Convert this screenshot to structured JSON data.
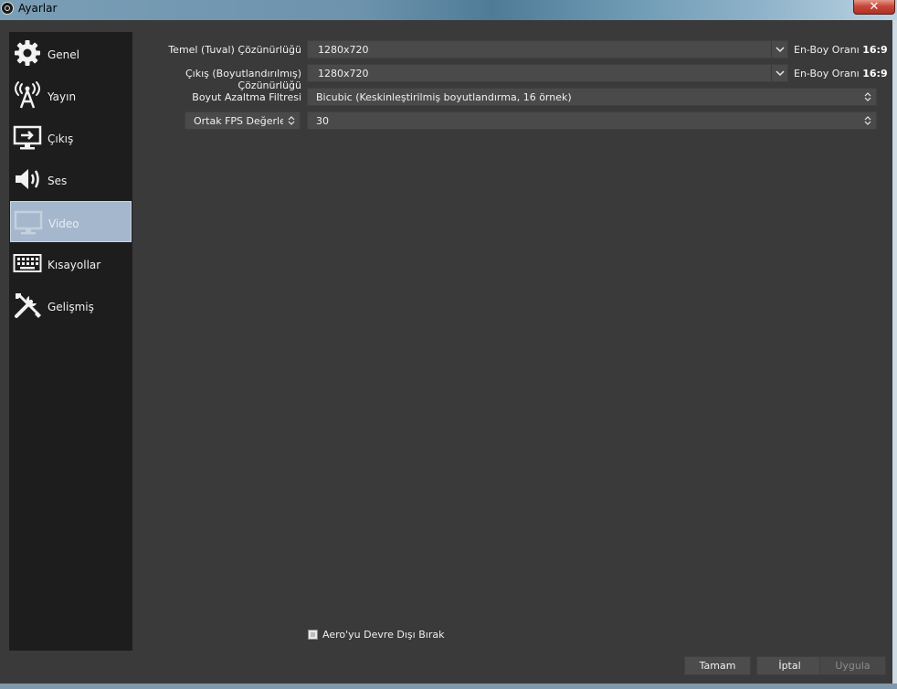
{
  "window": {
    "title": "Ayarlar",
    "close_label": "✕"
  },
  "sidebar": {
    "items": [
      {
        "label": "Genel",
        "icon": "gear-icon"
      },
      {
        "label": "Yayın",
        "icon": "broadcast-antenna-icon"
      },
      {
        "label": "Çıkış",
        "icon": "output-monitor-icon"
      },
      {
        "label": "Ses",
        "icon": "speaker-icon"
      },
      {
        "label": "Video",
        "icon": "monitor-icon",
        "selected": true
      },
      {
        "label": "Kısayollar",
        "icon": "keyboard-icon"
      },
      {
        "label": "Gelişmiş",
        "icon": "tools-icon"
      }
    ]
  },
  "video": {
    "base_resolution": {
      "label": "Temel (Tuval) Çözünürlüğü",
      "value": "1280x720",
      "aspect_label": "En-Boy Oranı",
      "aspect_value": "16:9"
    },
    "output_resolution": {
      "label": "Çıkış (Boyutlandırılmış) Çözünürlüğü",
      "value": "1280x720",
      "aspect_label": "En-Boy Oranı",
      "aspect_value": "16:9"
    },
    "downscale_filter": {
      "label": "Boyut Azaltma Filtresi",
      "value": "Bicubic (Keskinleştirilmiş boyutlandırma, 16 örnek)"
    },
    "fps": {
      "type_label": "Ortak FPS Değerleri",
      "value": "30"
    },
    "disable_aero": {
      "label": "Aero'yu Devre Dışı Bırak",
      "checked": false
    }
  },
  "buttons": {
    "ok": "Tamam",
    "cancel": "İptal",
    "apply": "Uygula"
  },
  "colors": {
    "background": "#3a3a3a",
    "sidebar": "#1d1d1d",
    "selected": "#a5b7cc",
    "field": "#4a4a4a"
  }
}
